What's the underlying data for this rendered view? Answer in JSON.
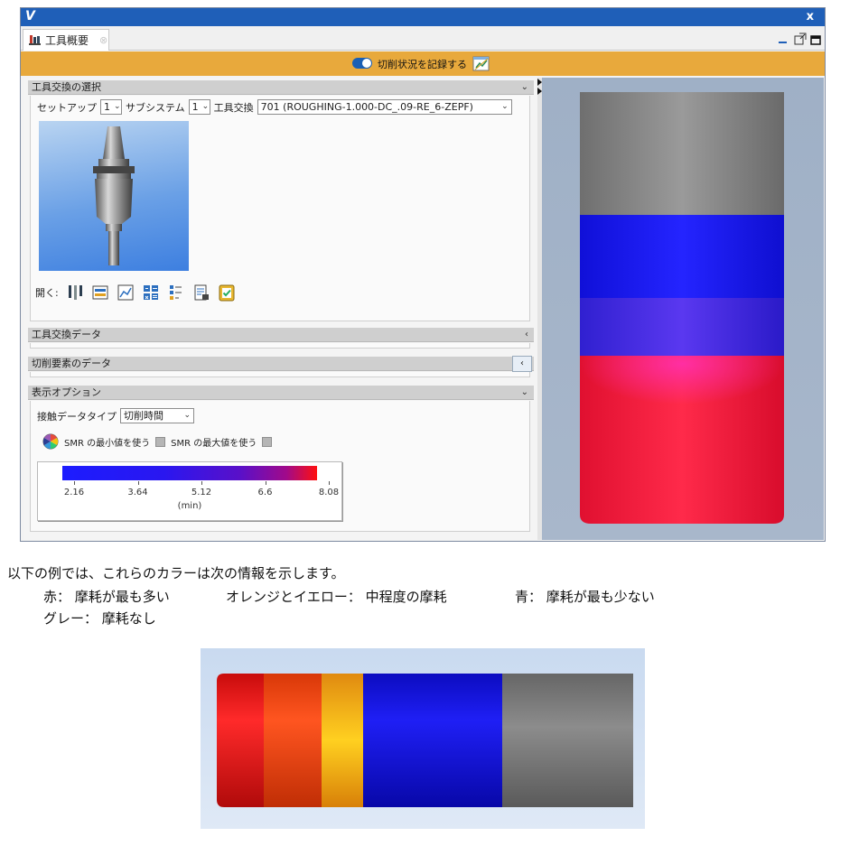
{
  "window": {
    "app_logo_letter": "V",
    "close_label": "x"
  },
  "tab": {
    "label": "工具概要",
    "close_glyph": "⊗"
  },
  "record_bar": {
    "label": "切削状況を記録する",
    "toggle_on": true
  },
  "sections": {
    "tool_change_select": "工具交換の選択",
    "tool_change_data": "工具交換データ",
    "cutting_element_data": "切削要素のデータ",
    "display_options": "表示オプション",
    "collapse_glyph": "⌄",
    "expand_glyph": "‹"
  },
  "selectors": {
    "setup_label": "セットアップ",
    "setup_value": "1",
    "subsystem_label": "サブシステム",
    "subsystem_value": "1",
    "tool_change_label": "工具交換",
    "tool_change_value": "701 (ROUGHING-1.000-DC_.09-RE_6-ZEPF)",
    "arrow": "⌄"
  },
  "open_row": {
    "label": "開く:",
    "icons": [
      "tool-holder-icon",
      "layers-icon",
      "graph-icon",
      "calculator-icon",
      "list-settings-icon",
      "report-icon",
      "checklist-icon"
    ]
  },
  "display_options": {
    "contact_type_label": "接触データタイプ",
    "contact_type_value": "切削時間",
    "smr_min_label": "SMR の最小値を使う",
    "smr_max_label": "SMR の最大値を使う",
    "smr_min_checked": false,
    "smr_max_checked": false
  },
  "color_legend": {
    "ticks": [
      "2.16",
      "3.64",
      "5.12",
      "6.6",
      "8.08"
    ],
    "unit": "(min)",
    "colors": [
      "#1c1cff",
      "#5a10c8",
      "#ff1010"
    ]
  },
  "viewport": {
    "bands": [
      "#8a8a8a",
      "#1515f2",
      "#4a2ad8",
      "#f01030"
    ]
  },
  "explanation": {
    "intro": "以下の例では、これらのカラーは次の情報を示します。",
    "red": "赤：  摩耗が最も多い",
    "orange_yellow": "オレンジとイエロー：  中程度の摩耗",
    "blue": "青：  摩耗が最も少ない",
    "gray": "グレー：  摩耗なし"
  },
  "example_bands": {
    "colors": [
      "#f51818",
      "#ff4010",
      "#ffb21a",
      "#1212e6",
      "#7e7e7e"
    ]
  }
}
